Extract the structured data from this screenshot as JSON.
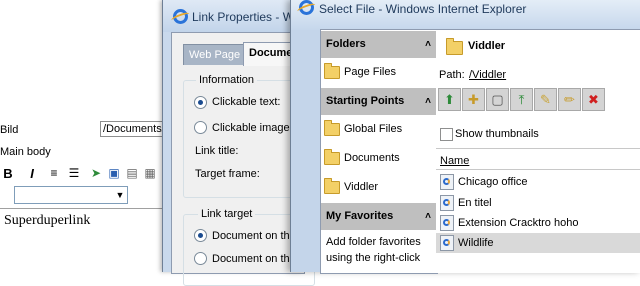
{
  "editor": {
    "field_label": "Bild",
    "path_value": "/Documents/",
    "section_label": "Main body",
    "toolbar": [
      {
        "icon": "bold-icon",
        "glyph": "B"
      },
      {
        "icon": "italic-icon",
        "glyph": "I"
      },
      {
        "icon": "numbered-list-icon",
        "glyph": "≡"
      },
      {
        "icon": "bullet-list-icon",
        "glyph": "☰"
      },
      {
        "icon": "insert-link-icon",
        "glyph": "➤"
      },
      {
        "icon": "insert-image-icon",
        "glyph": "▣"
      },
      {
        "icon": "insert-document-icon",
        "glyph": "▤"
      },
      {
        "icon": "insert-table-icon",
        "glyph": "▦"
      }
    ],
    "content_text": "Superduperlink"
  },
  "link_properties": {
    "title": "Link Properties - Wi",
    "tabs": {
      "web_page": "Web Page",
      "document": "Document"
    },
    "information_legend": "Information",
    "clickable_text": "Clickable text:",
    "clickable_image": "Clickable image:",
    "link_title": "Link title:",
    "target_frame": "Target frame:",
    "link_target_legend": "Link target",
    "doc_on_this": "Document on this",
    "doc_on_the": "Document on the"
  },
  "select_file": {
    "title": "Select File - Windows Internet Explorer",
    "sections": {
      "folders": "Folders",
      "starting_points": "Starting Points",
      "my_favorites": "My Favorites"
    },
    "folders_items": [
      "Page Files"
    ],
    "starting_points_items": [
      "Global Files",
      "Documents",
      "Viddler"
    ],
    "favorites_note": "Add folder favorites using the right-click",
    "current_folder": "Viddler",
    "path_label": "Path:",
    "path_value": "/Viddler",
    "toolbar": [
      {
        "icon": "go-up-folder-icon",
        "glyph": "⬆"
      },
      {
        "icon": "new-folder-icon",
        "glyph": "✚"
      },
      {
        "icon": "new-file-icon",
        "glyph": "▢"
      },
      {
        "icon": "upload-icon",
        "glyph": "⤒"
      },
      {
        "icon": "rename-icon",
        "glyph": "✎"
      },
      {
        "icon": "edit-folder-icon",
        "glyph": "✏"
      },
      {
        "icon": "delete-icon",
        "glyph": "✖"
      }
    ],
    "show_thumbnails": "Show thumbnails",
    "column_name": "Name",
    "files": [
      "Chicago office",
      "En titel",
      "Extension Cracktro hoho",
      "Wildlife"
    ],
    "selected_file": "Wildlife"
  }
}
